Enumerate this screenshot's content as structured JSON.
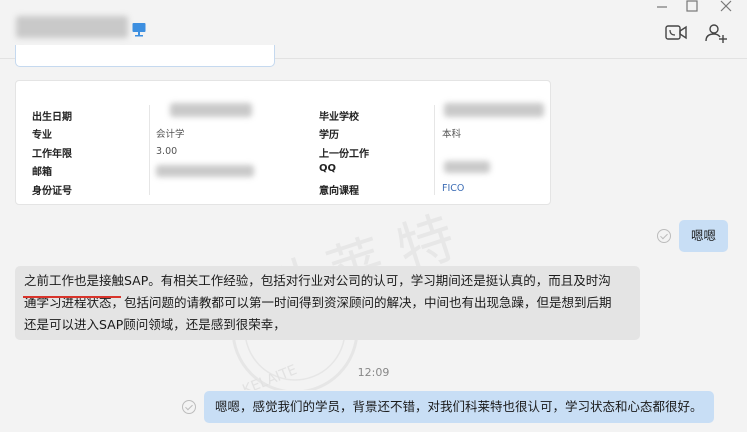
{
  "header": {
    "icons": [
      "monitor-icon",
      "video-call-icon",
      "add-contact-icon",
      "minimize-icon",
      "maximize-icon",
      "close-icon"
    ]
  },
  "profile": {
    "birth_date_label": "出生日期",
    "major_label": "专业",
    "major_value": "会计学",
    "work_years_label": "工作年限",
    "work_years_value": "3.00",
    "email_label": "邮箱",
    "id_label": "身份证号",
    "school_label": "毕业学校",
    "degree_label": "学历",
    "degree_value": "本科",
    "last_job_label": "上一份工作",
    "qq_label": "QQ",
    "course_label": "意向课程",
    "course_value": "FICO"
  },
  "messages": {
    "outgoing_1": "嗯嗯",
    "incoming_1_line1": "之前工作也是接触SAP。有相关工作经验，包括对行业对公司的认可，学习期间还是挺认真的，而且及时沟",
    "incoming_1_line2": "通学习进程状态，包括问题的请教都可以第一时间得到资深顾问的解决，中间也有出现急躁，但是想到后期",
    "incoming_1_line3": "还是可以进入SAP顾问领域，还是感到很荣幸，",
    "timestamp": "12:09",
    "outgoing_2": "嗯嗯，感觉我们的学员，背景还不错，对我们科莱特也很认可，学习状态和心态都很好。"
  },
  "watermark": {
    "text_cn": "科 莱 特",
    "text_en": "KELAITE"
  },
  "colors": {
    "incoming_bubble": "#e4e4e4",
    "outgoing_bubble": "#c8def5",
    "underline": "#d8342b",
    "link": "#3d6db5"
  }
}
